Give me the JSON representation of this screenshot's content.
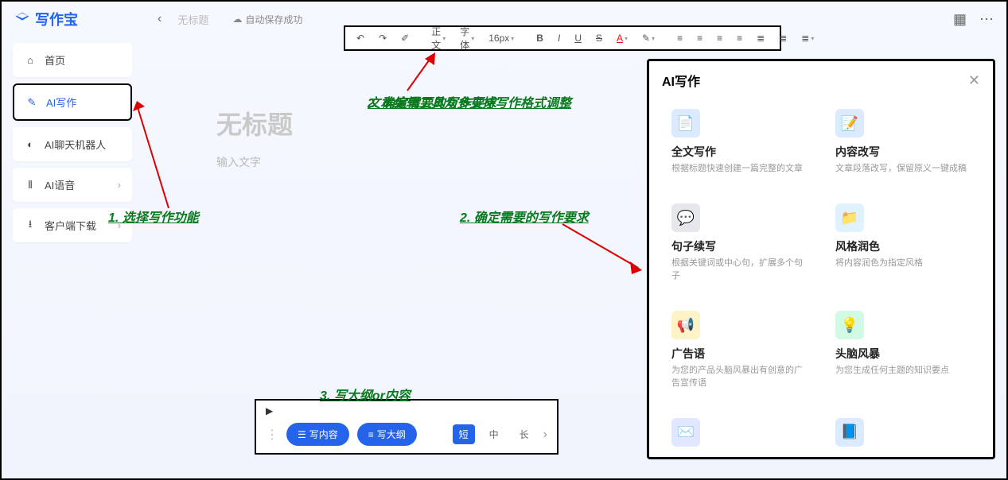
{
  "app": {
    "name": "写作宝"
  },
  "header": {
    "doc_title": "无标题",
    "autosave": "自动保存成功"
  },
  "sidebar": {
    "items": [
      {
        "icon": "home",
        "label": "首页"
      },
      {
        "icon": "pencil",
        "label": "AI写作"
      },
      {
        "icon": "chat",
        "label": "AI聊天机器人"
      },
      {
        "icon": "voice",
        "label": "AI语音"
      },
      {
        "icon": "download",
        "label": "客户端下载"
      }
    ]
  },
  "toolbar": {
    "format_label": "正文",
    "font_label": "字体",
    "size_label": "16px"
  },
  "editor": {
    "title_placeholder": "无标题",
    "body_placeholder": "输入文字"
  },
  "bottom": {
    "write_content": "写内容",
    "write_outline": "写大纲",
    "length": {
      "short": "短",
      "medium": "中",
      "long": "长"
    }
  },
  "ai_panel": {
    "title": "AI写作",
    "cards": [
      {
        "title": "全文写作",
        "desc": "根据标题快速创建一篇完整的文章",
        "color": "#3b82f6"
      },
      {
        "title": "内容改写",
        "desc": "文章段落改写，保留原义一键成稿",
        "color": "#60a5fa"
      },
      {
        "title": "句子续写",
        "desc": "根据关键词或中心句，扩展多个句子",
        "color": "#94a3b8"
      },
      {
        "title": "风格润色",
        "desc": "将内容润色为指定风格",
        "color": "#38bdf8"
      },
      {
        "title": "广告语",
        "desc": "为您的产品头脑风暴出有创意的广告宣传语",
        "color": "#fbbf24"
      },
      {
        "title": "头脑风暴",
        "desc": "为您生成任何主题的知识要点",
        "color": "#34d399"
      },
      {
        "title": "",
        "desc": "",
        "color": "#818cf8"
      },
      {
        "title": "",
        "desc": "",
        "color": "#2563eb"
      }
    ]
  },
  "annotations": {
    "a1": "1. 选择写作功能",
    "a2": "文本编辑工具众多支持写作格式调整",
    "a3": "2. 确定需要的写作要求",
    "a4": "3. 写大纲or内容"
  }
}
